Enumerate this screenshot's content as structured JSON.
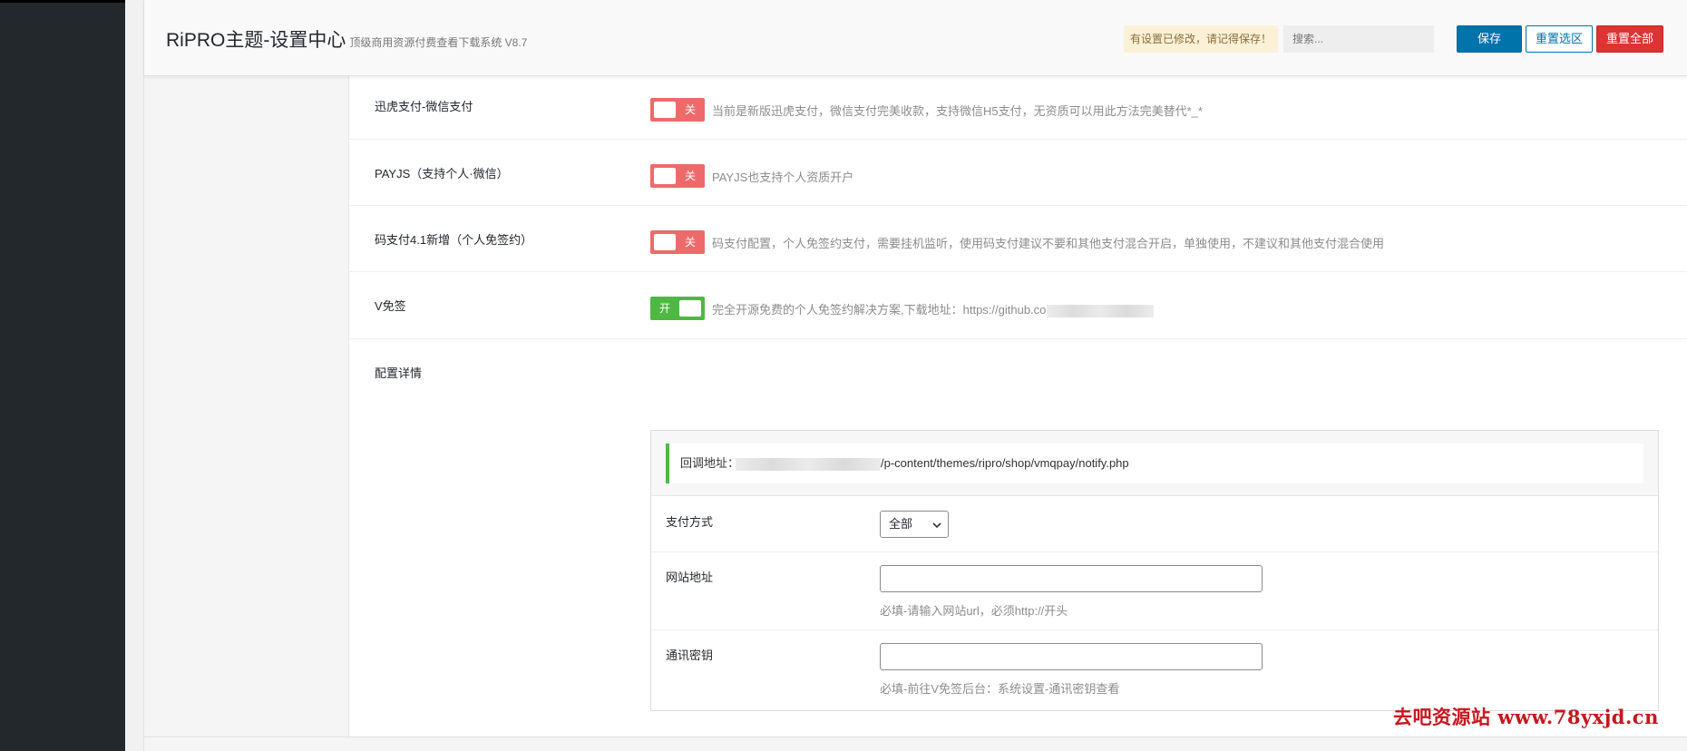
{
  "header": {
    "title": "RiPRO主题-设置中心",
    "subtitle": "顶级商用资源付费查看下载系统 V8.7",
    "notice": "有设置已修改，请记得保存！",
    "search_placeholder": "搜索...",
    "save_label": "保存",
    "reset_section_label": "重置选区",
    "reset_all_label": "重置全部"
  },
  "fields": [
    {
      "label": "迅虎支付-微信支付",
      "state": "off",
      "switch_text": "关",
      "desc": "当前是新版迅虎支付，微信支付完美收款，支持微信H5支付，无资质可以用此方法完美替代*_*"
    },
    {
      "label": "PAYJS（支持个人·微信）",
      "state": "off",
      "switch_text": "关",
      "desc": "PAYJS也支持个人资质开户"
    },
    {
      "label": "码支付4.1新增（个人免签约）",
      "state": "off",
      "switch_text": "关",
      "desc": "码支付配置，个人免签约支付，需要挂机监听，使用码支付建议不要和其他支付混合开启，单独使用，不建议和其他支付混合使用"
    },
    {
      "label": "V免签",
      "state": "on",
      "switch_text": "开",
      "desc": "完全开源免费的个人免签约解决方案,下载地址：https://github.cor"
    }
  ],
  "config": {
    "label": "配置详情",
    "callback_label": "回调地址：",
    "callback_path": "/p-content/themes/ripro/shop/vmqpay/notify.php",
    "pay_method_label": "支付方式",
    "pay_method_value": "全部",
    "site_url_label": "网站地址",
    "site_url_value": "",
    "site_url_help": "必填-请输入网站url，必须http://开头",
    "secret_label": "通讯密钥",
    "secret_value": "",
    "secret_help": "必填-前往V免签后台：系统设置-通讯密钥查看"
  },
  "watermark": "去吧资源站 www.78yxjd.cn",
  "colors": {
    "primary": "#0073aa",
    "danger": "#dd3333",
    "switch_off": "#ee6a6a",
    "switch_on": "#4fb845",
    "notice_bg": "#fbf1d6"
  }
}
